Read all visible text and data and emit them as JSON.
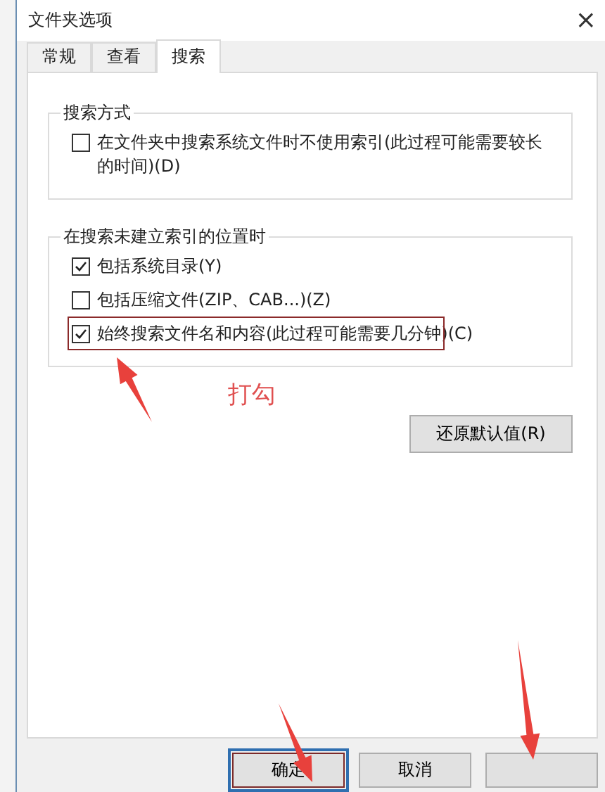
{
  "window": {
    "title": "文件夹选项",
    "close": "×"
  },
  "tabs": [
    {
      "label": "常规",
      "selected": false
    },
    {
      "label": "查看",
      "selected": false
    },
    {
      "label": "搜索",
      "selected": true
    }
  ],
  "groups": [
    {
      "title": "搜索方式",
      "options": [
        {
          "label": "在文件夹中搜索系统文件时不使用索引(此过程可能需要较长的时间)(D)",
          "checked": false
        }
      ]
    },
    {
      "title": "在搜索未建立索引的位置时",
      "options": [
        {
          "label": "包括系统目录(Y)",
          "checked": true
        },
        {
          "label": "包括压缩文件(ZIP、CAB...)(Z)",
          "checked": false
        },
        {
          "label": "始终搜索文件名和内容(此过程可能需要几分钟)(C)",
          "checked": true,
          "highlighted": true
        }
      ]
    }
  ],
  "restore_button": "还原默认值(R)",
  "annotation": {
    "label": "打勾"
  },
  "buttons": [
    {
      "label": "确定",
      "focused": true
    },
    {
      "label": "取消",
      "focused": false
    },
    {
      "focused": false
    }
  ]
}
